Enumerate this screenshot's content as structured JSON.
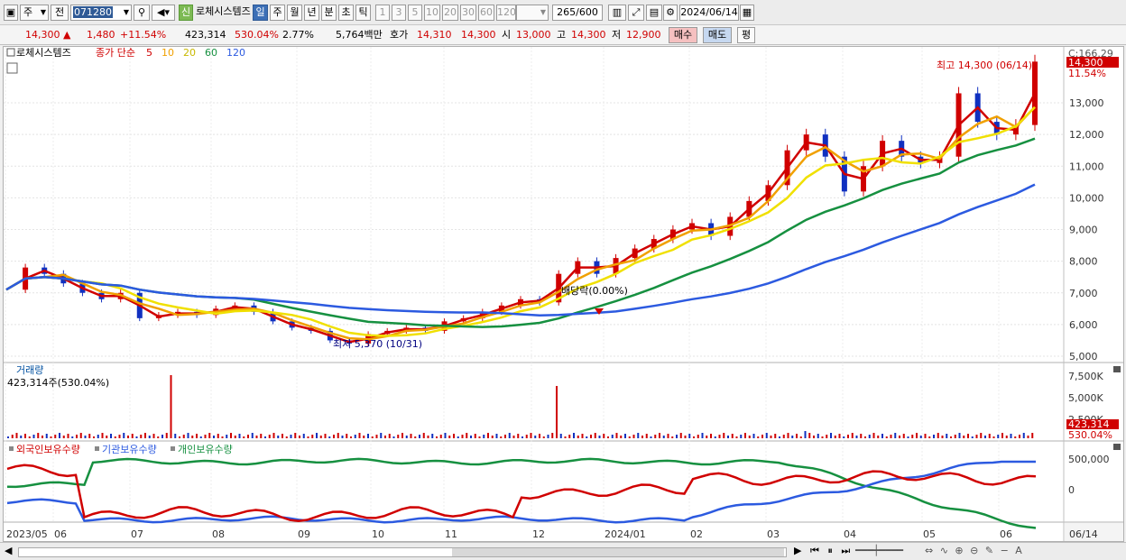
{
  "toolbar": {
    "market": "주",
    "prev_label": "전",
    "code": "071280",
    "stock_name": "로체시스템즈",
    "new_badge": "신",
    "periods": [
      "일",
      "주",
      "월",
      "년",
      "분",
      "초",
      "틱"
    ],
    "numbers": [
      "1",
      "3",
      "5",
      "10",
      "20",
      "30",
      "60",
      "120"
    ],
    "count": "265",
    "count_max": "/600",
    "date": "2024/06/14"
  },
  "quote": {
    "price": "14,300",
    "change": "1,480",
    "change_pct": "+11.54%",
    "volume": "423,314",
    "volume_pct": "530.04%",
    "turnover": "2.77%",
    "amount": "5,764백만",
    "hoga_label": "호가",
    "hoga": "14,310",
    "hoga2": "14,300",
    "open_label": "시",
    "open": "13,000",
    "high_label": "고",
    "high": "14,300",
    "low_label": "저",
    "low": "12,900",
    "buy_label": "매수",
    "sell_label": "매도",
    "flat_label": "평"
  },
  "chart_data": {
    "type": "line",
    "title": "로체시스템즈",
    "legend": {
      "price_label": "종가 단순",
      "ma_periods": [
        "5",
        "10",
        "20",
        "60",
        "120"
      ],
      "ma_colors": [
        "#d00000",
        "#f0a000",
        "#f0e000",
        "#169040",
        "#2c5ae0"
      ]
    },
    "annotations": {
      "high": "최고 14,300 (06/14)",
      "low": "최저 5,370 (10/31)",
      "dividend": "배당락(0.00%)",
      "right_top": "C:166.29",
      "last_price": "14,300",
      "last_pct": "11.54%"
    },
    "ylim": [
      5000,
      14300
    ],
    "y_ticks": [
      "13,000",
      "12,000",
      "11,000",
      "10,000",
      "9,000",
      "8,000",
      "7,000",
      "6,000",
      "5,000"
    ],
    "x_ticks": [
      "2023/05",
      "06",
      "07",
      "08",
      "09",
      "10",
      "11",
      "12",
      "2024/01",
      "02",
      "03",
      "04",
      "05",
      "06",
      "06/14"
    ],
    "close_approx": [
      7100,
      7800,
      7600,
      7300,
      7000,
      6800,
      7000,
      6200,
      6300,
      6400,
      6300,
      6500,
      6600,
      6400,
      6100,
      5900,
      5800,
      5500,
      5400,
      5700,
      5800,
      5900,
      5800,
      6100,
      6200,
      6400,
      6600,
      6800,
      6700,
      7600,
      8000,
      7600,
      8100,
      8400,
      8700,
      9000,
      9200,
      8800,
      9400,
      9900,
      10400,
      11500,
      12000,
      11300,
      10200,
      11000,
      11800,
      11300,
      11100,
      11300,
      13300,
      12400,
      12000,
      12300,
      14300
    ],
    "volume_panel": {
      "title": "거래량",
      "current": "423,314주(530.04%)",
      "y_ticks": [
        "7,500K",
        "5,000K",
        "2,500K"
      ],
      "last_value": "423,314",
      "last_pct": "530.04%"
    },
    "holdings_panel": {
      "series": [
        "외국인보유수량",
        "기관보유수량",
        "개인보유수량"
      ],
      "colors": [
        "#d00000",
        "#2c5ae0",
        "#169040"
      ],
      "y_ticks": [
        "500,000",
        "0"
      ]
    }
  }
}
